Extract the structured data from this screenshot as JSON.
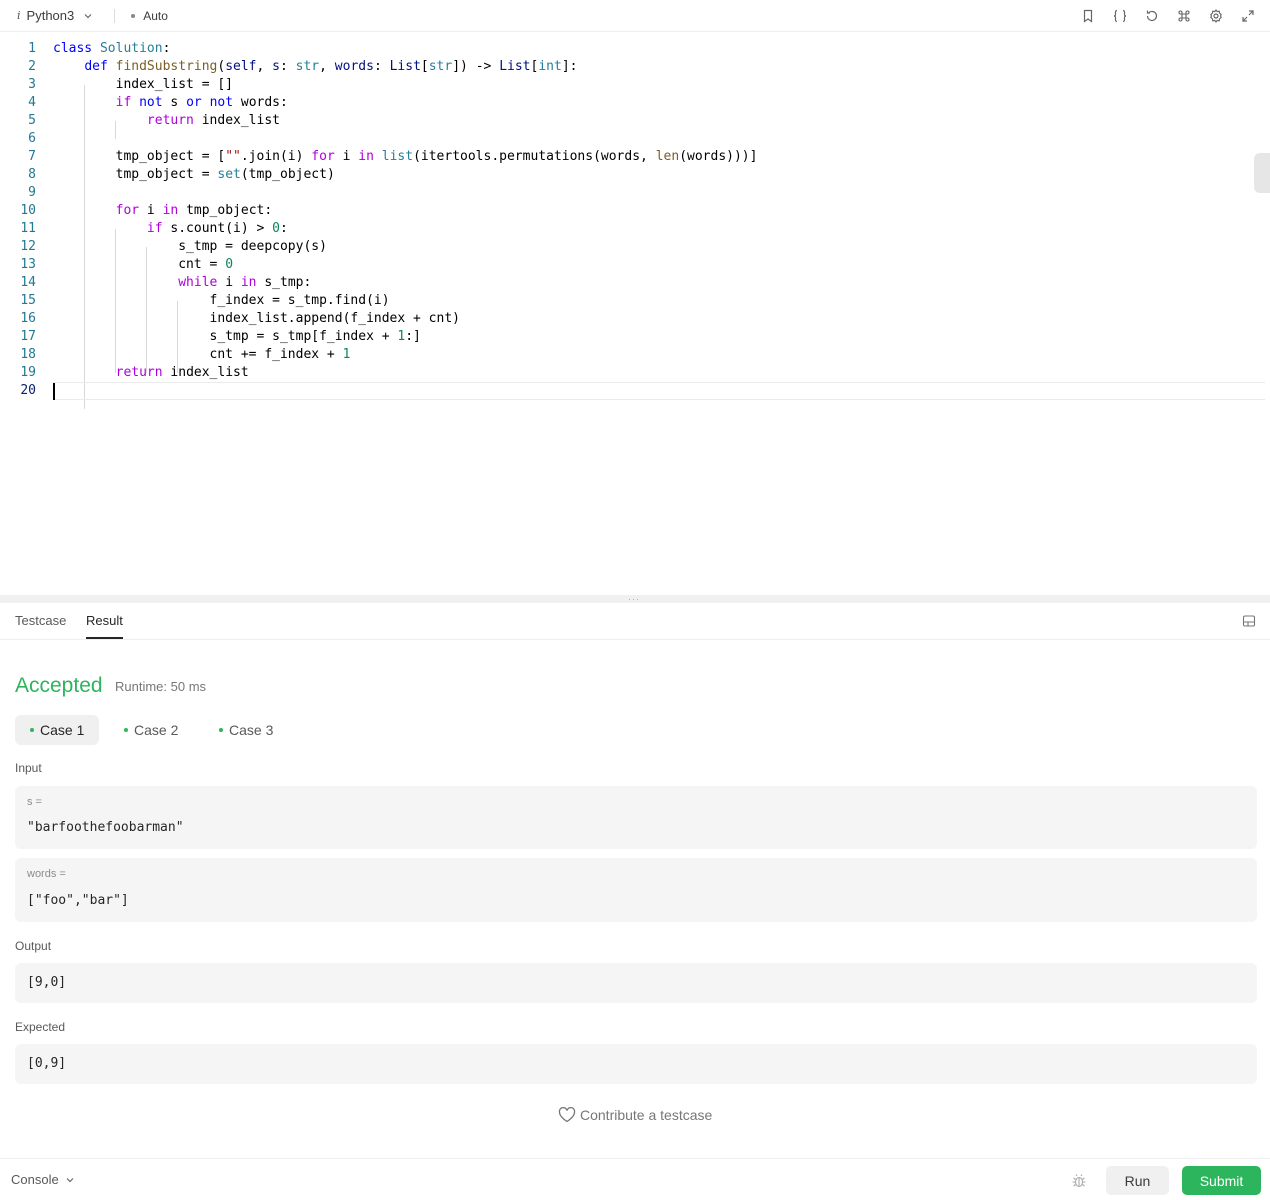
{
  "topbar": {
    "language_prefix": "i",
    "language": "Python3",
    "mode": "Auto"
  },
  "editor": {
    "lines": [
      {
        "n": "1",
        "html": "<span class=\"k\">class</span> <span class=\"cl\">Solution</span>:"
      },
      {
        "n": "2",
        "html": "    <span class=\"k\">def</span> <span class=\"fn\">findSubstring</span>(<span class=\"p\">self</span>, <span class=\"p\">s</span>: <span class=\"cl\">str</span>, <span class=\"p\">words</span>: <span class=\"p\">List</span>[<span class=\"cl\">str</span>]) -> <span class=\"p\">List</span>[<span class=\"cl\">int</span>]:"
      },
      {
        "n": "3",
        "html": "        index_list = []"
      },
      {
        "n": "4",
        "html": "        <span class=\"kc\">if</span> <span class=\"k\">not</span> s <span class=\"k\">or</span> <span class=\"k\">not</span> words:"
      },
      {
        "n": "5",
        "html": "            <span class=\"kc\">return</span> index_list"
      },
      {
        "n": "6",
        "html": ""
      },
      {
        "n": "7",
        "html": "        tmp_object = [<span class=\"s\">\"\"</span>.join(i) <span class=\"kc\">for</span> i <span class=\"kc\">in</span> <span class=\"cl\">list</span>(itertools.permutations(words, <span class=\"fn\">len</span>(words)))]"
      },
      {
        "n": "8",
        "html": "        tmp_object = <span class=\"cl\">set</span>(tmp_object)"
      },
      {
        "n": "9",
        "html": ""
      },
      {
        "n": "10",
        "html": "        <span class=\"kc\">for</span> i <span class=\"kc\">in</span> tmp_object:"
      },
      {
        "n": "11",
        "html": "            <span class=\"kc\">if</span> s.count(i) > <span class=\"n\">0</span>:"
      },
      {
        "n": "12",
        "html": "                s_tmp = deepcopy(s)"
      },
      {
        "n": "13",
        "html": "                cnt = <span class=\"n\">0</span>"
      },
      {
        "n": "14",
        "html": "                <span class=\"kc\">while</span> i <span class=\"kc\">in</span> s_tmp:"
      },
      {
        "n": "15",
        "html": "                    f_index = s_tmp.find(i)"
      },
      {
        "n": "16",
        "html": "                    index_list.append(f_index + cnt)"
      },
      {
        "n": "17",
        "html": "                    s_tmp = s_tmp[f_index + <span class=\"n\">1</span>:]"
      },
      {
        "n": "18",
        "html": "                    cnt += f_index + <span class=\"n\">1</span>"
      },
      {
        "n": "19",
        "html": "        <span class=\"kc\">return</span> index_list"
      },
      {
        "n": "20",
        "html": ""
      }
    ]
  },
  "panel": {
    "tabs": [
      "Testcase",
      "Result"
    ],
    "status": "Accepted",
    "runtime": "Runtime: 50 ms",
    "cases": [
      "Case 1",
      "Case 2",
      "Case 3"
    ],
    "input_label": "Input",
    "input_s_var": "s =",
    "input_s_val": "\"barfoothefoobarman\"",
    "input_words_var": "words =",
    "input_words_val": "[\"foo\",\"bar\"]",
    "output_label": "Output",
    "output_val": "[9,0]",
    "expected_label": "Expected",
    "expected_val": "[0,9]",
    "contribute": "Contribute a testcase"
  },
  "bottombar": {
    "console": "Console",
    "run": "Run",
    "submit": "Submit"
  },
  "colors": {
    "accent_green": "#2db55d"
  }
}
